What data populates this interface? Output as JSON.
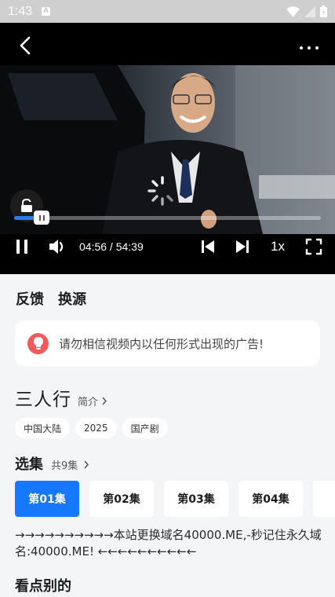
{
  "status_bar": {
    "time": "1:43",
    "notif_icon": "A"
  },
  "player": {
    "current_time": "04:56",
    "total_time": "54:39",
    "time_display": "04:56 / 54:39",
    "speed": "1x",
    "progress": 0.055,
    "accent": "#2b7bef"
  },
  "tabs": [
    "反馈",
    "换源"
  ],
  "notice": {
    "text": "请勿相信视频内以任何形式出现的广告!"
  },
  "show": {
    "title": "三人行",
    "intro_label": "简介",
    "tags": [
      "中国大陆",
      "2025",
      "国产剧"
    ]
  },
  "episodes": {
    "heading": "选集",
    "count_label": "共9集",
    "items": [
      "第01集",
      "第02集",
      "第03集",
      "第04集"
    ],
    "selected": "第01集",
    "accent": "#1677ff"
  },
  "domain_notice": "→→→→→→→→→→本站更换域名40000.ME,-秒记住永久域名:40000.ME! ←←←←←←←←←←",
  "recommend_heading": "看点别的"
}
